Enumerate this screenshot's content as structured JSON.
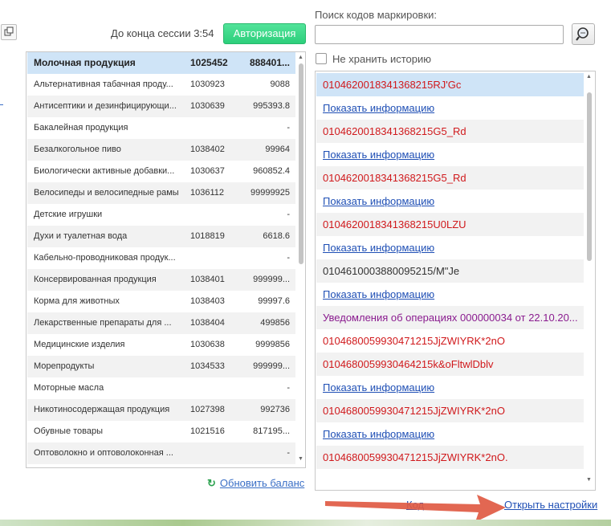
{
  "header": {
    "session_label": "До конца сессии 3:54",
    "auth_button": "Авторизация"
  },
  "products": {
    "rows": [
      {
        "name": "Молочная продукция",
        "code": "1025452",
        "balance": "888401..."
      },
      {
        "name": "Альтернативная табачная проду...",
        "code": "1030923",
        "balance": "9088"
      },
      {
        "name": "Антисептики и дезинфицирующи...",
        "code": "1030639",
        "balance": "995393.8"
      },
      {
        "name": "Бакалейная продукция",
        "code": "",
        "balance": "-"
      },
      {
        "name": "Безалкогольное пиво",
        "code": "1038402",
        "balance": "99964"
      },
      {
        "name": "Биологически активные добавки...",
        "code": "1030637",
        "balance": "960852.4"
      },
      {
        "name": "Велосипеды и велосипедные рамы",
        "code": "1036112",
        "balance": "99999925"
      },
      {
        "name": "Детские игрушки",
        "code": "",
        "balance": "-"
      },
      {
        "name": "Духи и туалетная вода",
        "code": "1018819",
        "balance": "6618.6"
      },
      {
        "name": "Кабельно-проводниковая продук...",
        "code": "",
        "balance": "-"
      },
      {
        "name": "Консервированная продукция",
        "code": "1038401",
        "balance": "999999..."
      },
      {
        "name": "Корма для животных",
        "code": "1038403",
        "balance": "99997.6"
      },
      {
        "name": "Лекарственные препараты для ...",
        "code": "1038404",
        "balance": "499856"
      },
      {
        "name": "Медицинские изделия",
        "code": "1030638",
        "balance": "9999856"
      },
      {
        "name": "Морепродукты",
        "code": "1034533",
        "balance": "999999..."
      },
      {
        "name": "Моторные масла",
        "code": "",
        "balance": "-"
      },
      {
        "name": "Никотиносодержащая продукция",
        "code": "1027398",
        "balance": "992736"
      },
      {
        "name": "Обувные товары",
        "code": "1021516",
        "balance": "817195..."
      },
      {
        "name": "Оптоволокно и оптоволоконная ...",
        "code": "",
        "balance": "-"
      }
    ],
    "refresh_label": "Обновить баланс"
  },
  "search": {
    "label": "Поиск кодов маркировки:",
    "value": "",
    "no_history_label": "Не хранить историю"
  },
  "history": {
    "rows": [
      {
        "text": "0104620018341368215RJ'Gc",
        "kind": "red"
      },
      {
        "text": "Показать информацию",
        "kind": "link"
      },
      {
        "text": "0104620018341368215G5_Rd",
        "kind": "red"
      },
      {
        "text": "Показать информацию",
        "kind": "link"
      },
      {
        "text": "0104620018341368215G5_Rd",
        "kind": "red"
      },
      {
        "text": "Показать информацию",
        "kind": "link"
      },
      {
        "text": "0104620018341368215U0LZU",
        "kind": "red"
      },
      {
        "text": "Показать информацию",
        "kind": "link"
      },
      {
        "text": "0104610003880095215/M\"Je",
        "kind": "black"
      },
      {
        "text": "Показать информацию",
        "kind": "link"
      },
      {
        "text": "Уведомления об операциях 000000034 от 22.10.20...",
        "kind": "purple"
      },
      {
        "text": "0104680059930471215JjZWIYRK*2nO",
        "kind": "red"
      },
      {
        "text": "0104680059930464215k&oFltwlDblv",
        "kind": "red"
      },
      {
        "text": "Показать информацию",
        "kind": "link"
      },
      {
        "text": "0104680059930471215JjZWIYRK*2nO",
        "kind": "red"
      },
      {
        "text": "Показать информацию",
        "kind": "link"
      },
      {
        "text": "0104680059930471215JjZWIYRK*2nO.",
        "kind": "red"
      }
    ],
    "open_settings": "Открыть настройки"
  },
  "colors": {
    "accent_green": "#2ccf7b",
    "link_blue": "#1f4fb5",
    "error_red": "#d0191c",
    "notice_purple": "#8a1c8f",
    "selection": "#cfe4f7",
    "annotation_arrow": "#e05a43"
  },
  "icons": {
    "restore": "restore-window-icon",
    "search": "magnifier-icon",
    "refresh": "refresh-icon",
    "annotation": "red-arrow-annotation"
  }
}
